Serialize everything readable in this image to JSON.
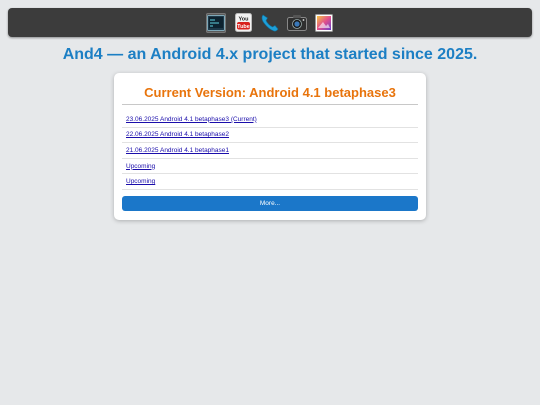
{
  "dock": {
    "icons": [
      {
        "name": "terminal-icon",
        "active": true
      },
      {
        "name": "youtube-icon",
        "label": "You Tube"
      },
      {
        "name": "phone-icon"
      },
      {
        "name": "camera-icon"
      },
      {
        "name": "gallery-icon"
      }
    ]
  },
  "headline": "And4 — an Android 4.x project that started since 2025.",
  "card": {
    "title": "Current Version: Android 4.1 betaphase3",
    "releases": [
      "23.06.2025 Android 4.1 betaphase3 (Current)",
      "22.06.2025 Android 4.1 betaphase2",
      "21.06.2025 Android 4.1 betaphase1",
      "Upcoming",
      "Upcoming"
    ],
    "more_label": "More..."
  },
  "colors": {
    "headline": "#1c7fc4",
    "card_title": "#e8740c",
    "link": "#1a0dab",
    "button": "#1b77c9",
    "dock": "#3c3c3c",
    "background": "#e6e8ea"
  }
}
